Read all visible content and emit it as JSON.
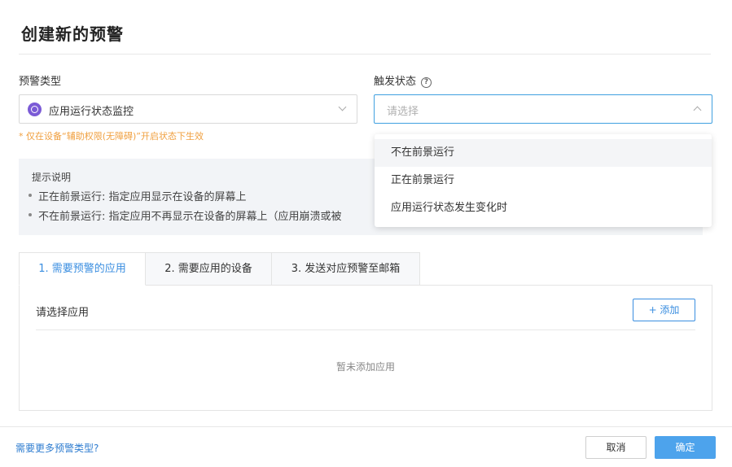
{
  "dialog": {
    "title": "创建新的预警"
  },
  "form": {
    "alert_type": {
      "label": "预警类型",
      "value": "应用运行状态监控",
      "note": "* 仅在设备“辅助权限(无障碍)”开启状态下生效"
    },
    "trigger_state": {
      "label": "触发状态",
      "help_icon": "?",
      "placeholder": "请选择",
      "options": [
        "不在前景运行",
        "正在前景运行",
        "应用运行状态发生变化时"
      ]
    }
  },
  "tips": {
    "heading": "提示说明",
    "items": [
      "正在前景运行: 指定应用显示在设备的屏幕上",
      "不在前景运行: 指定应用不再显示在设备的屏幕上（应用崩溃或被"
    ]
  },
  "tabs": [
    "1. 需要预警的应用",
    "2. 需要应用的设备",
    "3. 发送对应预警至邮箱"
  ],
  "panel": {
    "label": "请选择应用",
    "add_button": "+ 添加",
    "empty_text": "暂未添加应用"
  },
  "footer": {
    "more_link": "需要更多预警类型?",
    "cancel": "取消",
    "confirm": "确定"
  },
  "colors": {
    "accent": "#3a8ee0",
    "primary_button": "#4da3ec",
    "warning_note": "#f0a040",
    "app_icon": "#7b5bd6"
  }
}
